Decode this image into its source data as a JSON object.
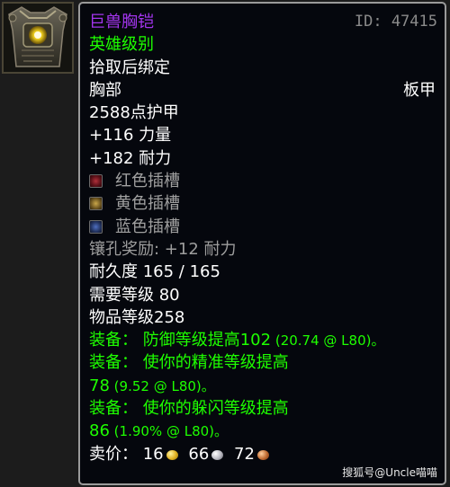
{
  "item": {
    "name": "巨兽胸铠",
    "id_label": "ID: 47415",
    "quality": "英雄级别",
    "binding": "拾取后绑定",
    "slot": "胸部",
    "armor_type": "板甲",
    "armor": "2588点护甲",
    "stats": [
      "+116 力量",
      "+182 耐力"
    ],
    "sockets": [
      {
        "color": "red",
        "label": "红色插槽",
        "icon": "red-socket-icon"
      },
      {
        "color": "yellow",
        "label": "黄色插槽",
        "icon": "yellow-socket-icon"
      },
      {
        "color": "blue",
        "label": "蓝色插槽",
        "icon": "blue-socket-icon"
      }
    ],
    "socket_bonus": "镶孔奖励: +12 耐力",
    "durability": "耐久度 165 / 165",
    "required_level": "需要等级 80",
    "item_level": "物品等级258",
    "equip_effects": [
      {
        "main": "装备： 防御等级提高102",
        "detail": " (20.74 @ L80)。"
      },
      {
        "main": "装备： 使你的精准等级提高",
        "value": "78",
        "detail": " (9.52 @ L80)。"
      },
      {
        "main": "装备： 使你的躲闪等级提高",
        "value": "86",
        "detail": " (1.90% @ L80)。"
      }
    ],
    "sell_price": {
      "label": "卖价：",
      "gold": "16",
      "silver": "66",
      "copper": "72"
    }
  },
  "watermark": "搜狐号@Uncle喵喵",
  "colors": {
    "epic": "#a335ee",
    "uncommon": "#1eff00",
    "background": "#05070d"
  }
}
